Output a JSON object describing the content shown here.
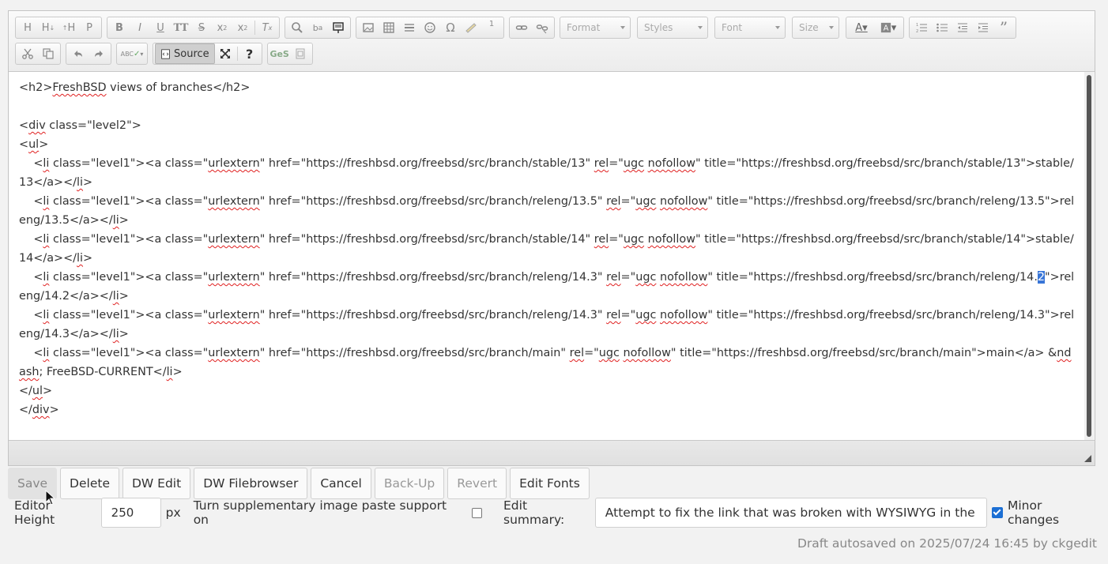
{
  "toolbar": {
    "format_label": "Format",
    "styles_label": "Styles",
    "font_label": "Font",
    "size_label": "Size",
    "source_label": "Source",
    "heading_h": "H",
    "heading_p": "P",
    "bold": "B",
    "italic": "I",
    "underline": "U",
    "omega": "Ω",
    "superscript_marker": "1",
    "help": "?",
    "quote": "”"
  },
  "source_lines": [
    "<h2>FreshBSD views of branches</h2>",
    "",
    "<div class=\"level2\">",
    "<ul>",
    "    <li class=\"level1\"><a class=\"urlextern\" href=\"https://freshbsd.org/freebsd/src/branch/stable/13\" rel=\"ugc nofollow\" title=\"https://freshbsd.org/freebsd/src/branch/stable/13\">stable/13</a></li>",
    "    <li class=\"level1\"><a class=\"urlextern\" href=\"https://freshbsd.org/freebsd/src/branch/releng/13.5\" rel=\"ugc nofollow\" title=\"https://freshbsd.org/freebsd/src/branch/releng/13.5\">releng/13.5</a></li>",
    "    <li class=\"level1\"><a class=\"urlextern\" href=\"https://freshbsd.org/freebsd/src/branch/stable/14\" rel=\"ugc nofollow\" title=\"https://freshbsd.org/freebsd/src/branch/stable/14\">stable/14</a></li>",
    "    <li class=\"level1\"><a class=\"urlextern\" href=\"https://freshbsd.org/freebsd/src/branch/releng/14.3\" rel=\"ugc nofollow\" title=\"https://freshbsd.org/freebsd/src/branch/releng/14.2\">releng/14.2</a></li>",
    "    <li class=\"level1\"><a class=\"urlextern\" href=\"https://freshbsd.org/freebsd/src/branch/releng/14.3\" rel=\"ugc nofollow\" title=\"https://freshbsd.org/freebsd/src/branch/releng/14.3\">releng/14.3</a></li>",
    "    <li class=\"level1\"><a class=\"urlextern\" href=\"https://freshbsd.org/freebsd/src/branch/main\" rel=\"ugc nofollow\" title=\"https://freshbsd.org/freebsd/src/branch/main\">main</a> &ndash; FreeBSD-CURRENT</li>",
    "</ul>",
    "</div>"
  ],
  "actions": {
    "save": "Save",
    "delete": "Delete",
    "dw_edit": "DW Edit",
    "dw_filebrowser": "DW Filebrowser",
    "cancel": "Cancel",
    "backup": "Back-Up",
    "revert": "Revert",
    "edit_fonts": "Edit Fonts"
  },
  "options": {
    "editor_height_label": "Editor Height",
    "editor_height_value": "250",
    "px_label": "px",
    "image_paste_label": "Turn supplementary image paste support on",
    "image_paste_checked": false,
    "edit_summary_label": "Edit summary:",
    "edit_summary_value": "Attempt to fix the link that was broken with WYSIWYG in the previous edit",
    "minor_changes_label": "Minor changes",
    "minor_changes_checked": true
  },
  "draft_status": "Draft autosaved on 2025/07/24 16:45 by ckgedit",
  "colors": {
    "selection": "#3875d7",
    "spell_underline": "#e02020",
    "checkbox_accent": "#1c6fd4"
  }
}
